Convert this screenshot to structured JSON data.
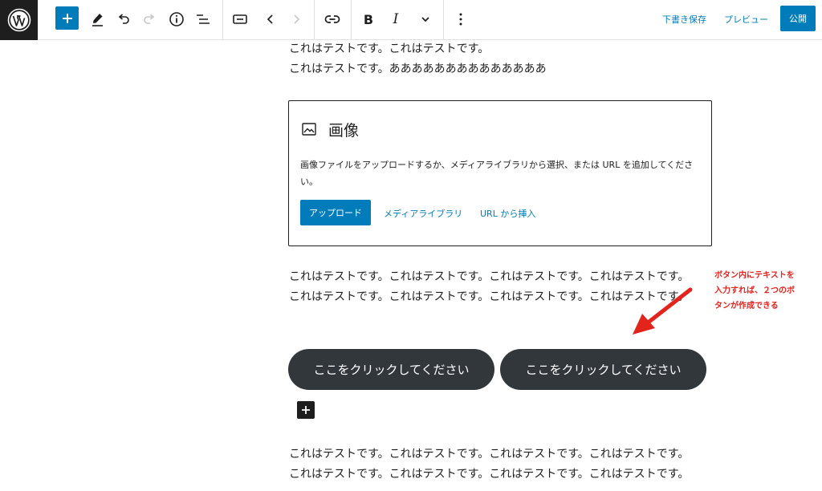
{
  "toolbar": {
    "icons": [
      "wordpress-logo",
      "plus-icon",
      "pencil-icon",
      "undo-icon",
      "redo-icon",
      "info-icon",
      "list-view-icon",
      "block-transform-icon",
      "chevron-left-icon",
      "chevron-right-icon",
      "link-icon",
      "bold-icon",
      "italic-icon",
      "chevron-down-icon",
      "more-vertical-icon"
    ],
    "bold_label": "B",
    "italic_label": "I",
    "save_draft": "下書き保存",
    "preview": "プレビュー",
    "publish": "公開"
  },
  "content": {
    "top_paragraph": {
      "line1": "これはテストです。これはテストです。",
      "line2": "これはテストです。ああああああああああああああ"
    },
    "image_block": {
      "title": "画像",
      "description": "画像ファイルをアップロードするか、メディアライブラリから選択、または URL を追加してください。",
      "upload_label": "アップロード",
      "media_library_label": "メディアライブラリ",
      "url_insert_label": "URL から挿入"
    },
    "middle_paragraph": {
      "line1": "これはテストです。これはテストです。これはテストです。これはテストです。",
      "line2": "これはテストです。これはテストです。これはテストです。これはテストです。"
    },
    "buttons": {
      "button1": "ここをクリックしてください",
      "button2": "ここをクリックしてください"
    },
    "bottom_paragraph": {
      "line1": "これはテストです。これはテストです。これはテストです。これはテストです。",
      "line2": "これはテストです。これはテストです。これはテストです。これはテストです。"
    }
  },
  "annotation": {
    "line1": "ボタン内にテキストを",
    "line2": "入力すれば、２つのボ",
    "line3": "タンが作成できる"
  },
  "colors": {
    "accent": "#007cba",
    "button_bg": "#32373c",
    "annotation": "#e3241d",
    "dark": "#1e1e1e"
  }
}
